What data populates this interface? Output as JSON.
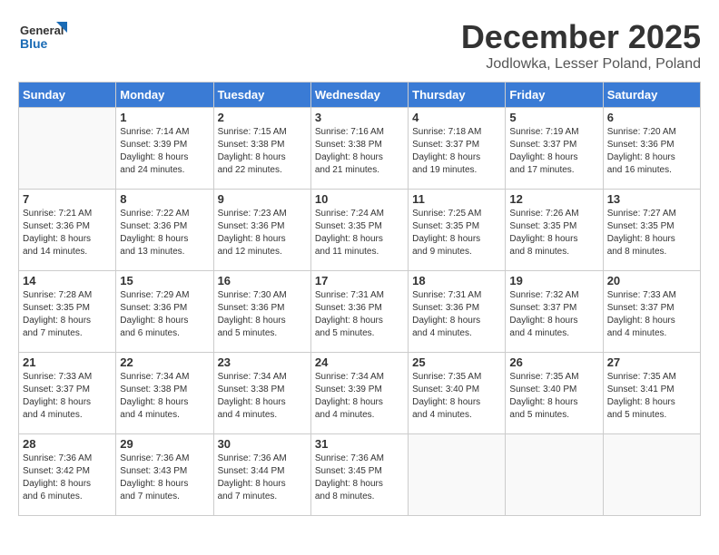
{
  "logo": {
    "line1": "General",
    "line2": "Blue"
  },
  "title": "December 2025",
  "location": "Jodlowka, Lesser Poland, Poland",
  "weekdays": [
    "Sunday",
    "Monday",
    "Tuesday",
    "Wednesday",
    "Thursday",
    "Friday",
    "Saturday"
  ],
  "weeks": [
    [
      {
        "day": "",
        "info": ""
      },
      {
        "day": "1",
        "info": "Sunrise: 7:14 AM\nSunset: 3:39 PM\nDaylight: 8 hours\nand 24 minutes."
      },
      {
        "day": "2",
        "info": "Sunrise: 7:15 AM\nSunset: 3:38 PM\nDaylight: 8 hours\nand 22 minutes."
      },
      {
        "day": "3",
        "info": "Sunrise: 7:16 AM\nSunset: 3:38 PM\nDaylight: 8 hours\nand 21 minutes."
      },
      {
        "day": "4",
        "info": "Sunrise: 7:18 AM\nSunset: 3:37 PM\nDaylight: 8 hours\nand 19 minutes."
      },
      {
        "day": "5",
        "info": "Sunrise: 7:19 AM\nSunset: 3:37 PM\nDaylight: 8 hours\nand 17 minutes."
      },
      {
        "day": "6",
        "info": "Sunrise: 7:20 AM\nSunset: 3:36 PM\nDaylight: 8 hours\nand 16 minutes."
      }
    ],
    [
      {
        "day": "7",
        "info": "Sunrise: 7:21 AM\nSunset: 3:36 PM\nDaylight: 8 hours\nand 14 minutes."
      },
      {
        "day": "8",
        "info": "Sunrise: 7:22 AM\nSunset: 3:36 PM\nDaylight: 8 hours\nand 13 minutes."
      },
      {
        "day": "9",
        "info": "Sunrise: 7:23 AM\nSunset: 3:36 PM\nDaylight: 8 hours\nand 12 minutes."
      },
      {
        "day": "10",
        "info": "Sunrise: 7:24 AM\nSunset: 3:35 PM\nDaylight: 8 hours\nand 11 minutes."
      },
      {
        "day": "11",
        "info": "Sunrise: 7:25 AM\nSunset: 3:35 PM\nDaylight: 8 hours\nand 9 minutes."
      },
      {
        "day": "12",
        "info": "Sunrise: 7:26 AM\nSunset: 3:35 PM\nDaylight: 8 hours\nand 8 minutes."
      },
      {
        "day": "13",
        "info": "Sunrise: 7:27 AM\nSunset: 3:35 PM\nDaylight: 8 hours\nand 8 minutes."
      }
    ],
    [
      {
        "day": "14",
        "info": "Sunrise: 7:28 AM\nSunset: 3:35 PM\nDaylight: 8 hours\nand 7 minutes."
      },
      {
        "day": "15",
        "info": "Sunrise: 7:29 AM\nSunset: 3:36 PM\nDaylight: 8 hours\nand 6 minutes."
      },
      {
        "day": "16",
        "info": "Sunrise: 7:30 AM\nSunset: 3:36 PM\nDaylight: 8 hours\nand 5 minutes."
      },
      {
        "day": "17",
        "info": "Sunrise: 7:31 AM\nSunset: 3:36 PM\nDaylight: 8 hours\nand 5 minutes."
      },
      {
        "day": "18",
        "info": "Sunrise: 7:31 AM\nSunset: 3:36 PM\nDaylight: 8 hours\nand 4 minutes."
      },
      {
        "day": "19",
        "info": "Sunrise: 7:32 AM\nSunset: 3:37 PM\nDaylight: 8 hours\nand 4 minutes."
      },
      {
        "day": "20",
        "info": "Sunrise: 7:33 AM\nSunset: 3:37 PM\nDaylight: 8 hours\nand 4 minutes."
      }
    ],
    [
      {
        "day": "21",
        "info": "Sunrise: 7:33 AM\nSunset: 3:37 PM\nDaylight: 8 hours\nand 4 minutes."
      },
      {
        "day": "22",
        "info": "Sunrise: 7:34 AM\nSunset: 3:38 PM\nDaylight: 8 hours\nand 4 minutes."
      },
      {
        "day": "23",
        "info": "Sunrise: 7:34 AM\nSunset: 3:38 PM\nDaylight: 8 hours\nand 4 minutes."
      },
      {
        "day": "24",
        "info": "Sunrise: 7:34 AM\nSunset: 3:39 PM\nDaylight: 8 hours\nand 4 minutes."
      },
      {
        "day": "25",
        "info": "Sunrise: 7:35 AM\nSunset: 3:40 PM\nDaylight: 8 hours\nand 4 minutes."
      },
      {
        "day": "26",
        "info": "Sunrise: 7:35 AM\nSunset: 3:40 PM\nDaylight: 8 hours\nand 5 minutes."
      },
      {
        "day": "27",
        "info": "Sunrise: 7:35 AM\nSunset: 3:41 PM\nDaylight: 8 hours\nand 5 minutes."
      }
    ],
    [
      {
        "day": "28",
        "info": "Sunrise: 7:36 AM\nSunset: 3:42 PM\nDaylight: 8 hours\nand 6 minutes."
      },
      {
        "day": "29",
        "info": "Sunrise: 7:36 AM\nSunset: 3:43 PM\nDaylight: 8 hours\nand 7 minutes."
      },
      {
        "day": "30",
        "info": "Sunrise: 7:36 AM\nSunset: 3:44 PM\nDaylight: 8 hours\nand 7 minutes."
      },
      {
        "day": "31",
        "info": "Sunrise: 7:36 AM\nSunset: 3:45 PM\nDaylight: 8 hours\nand 8 minutes."
      },
      {
        "day": "",
        "info": ""
      },
      {
        "day": "",
        "info": ""
      },
      {
        "day": "",
        "info": ""
      }
    ]
  ]
}
